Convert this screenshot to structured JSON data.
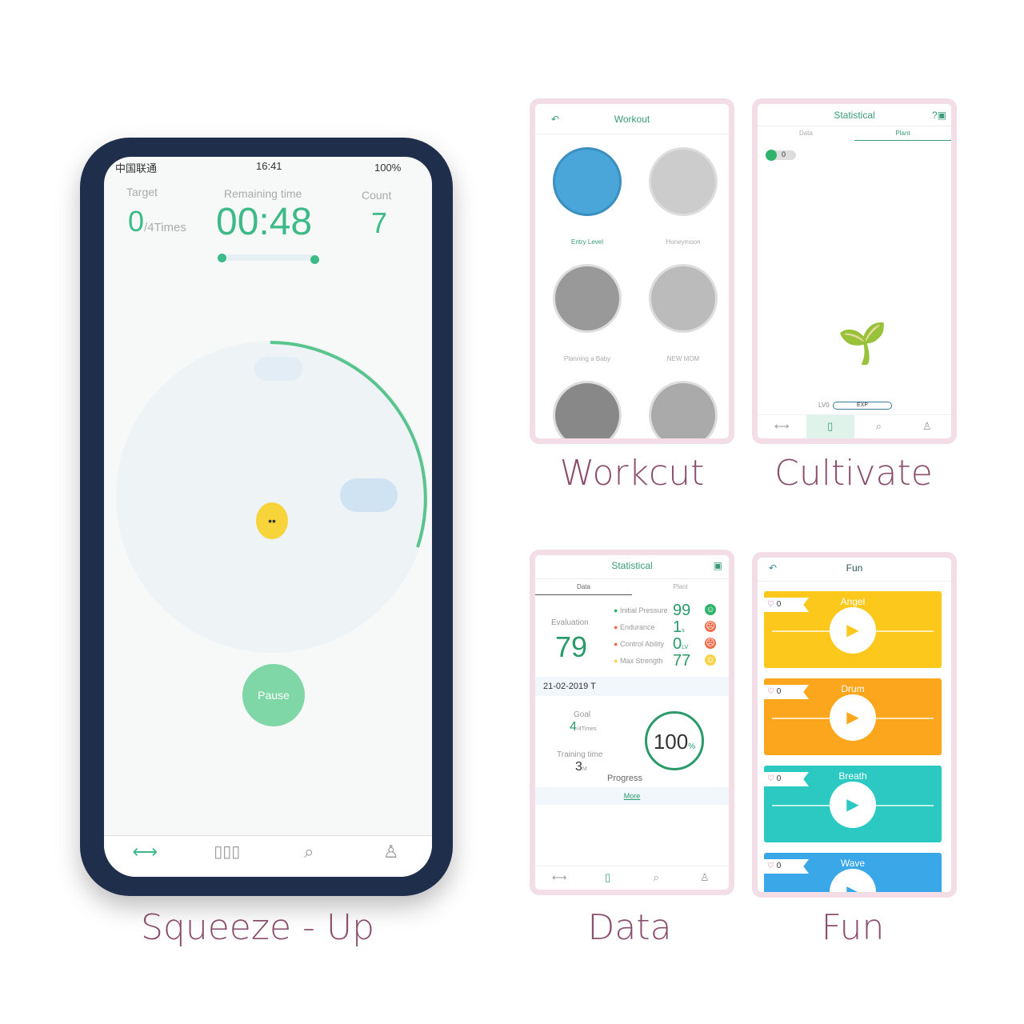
{
  "captions": {
    "workout": "Workcut",
    "cultivate": "Cultivate",
    "squeeze": "Squeeze - Up",
    "data": "Data",
    "fun": "Fun"
  },
  "main_phone": {
    "status": {
      "carrier": "中国联通",
      "time": "16:41",
      "battery": "100%"
    },
    "target_label": "Target",
    "target_value": "0",
    "target_unit": "/4Times",
    "remaining_label": "Remaining time",
    "remaining_value": "00:48",
    "count_label": "Count",
    "count_value": "7",
    "pause_label": "Pause",
    "nav": [
      {
        "icon": "dumbbell-icon"
      },
      {
        "icon": "bar-chart-icon"
      },
      {
        "icon": "search-icon"
      },
      {
        "icon": "user-icon"
      }
    ],
    "accent": "#3dba88"
  },
  "workout": {
    "title": "Workout",
    "items": [
      "Entry Level",
      "Honeymoon",
      "Planning a Baby",
      "NEW MOM"
    ]
  },
  "cultivate": {
    "title": "Statistical",
    "tabs": [
      "Data",
      "Plant"
    ],
    "toggle_value": "0",
    "level": "LV0",
    "exp": "EXP"
  },
  "data": {
    "title": "Statistical",
    "tabs": [
      "Data",
      "Plant"
    ],
    "evaluation_label": "Evaluation",
    "evaluation_value": "79",
    "metrics": [
      {
        "label": "Initial Pressure",
        "value": "99",
        "unit": "",
        "mood": "happy",
        "color": "#2fb36c"
      },
      {
        "label": "Endurance",
        "value": "1",
        "unit": "s",
        "mood": "sad",
        "color": "#f26b4a"
      },
      {
        "label": "Control Ability",
        "value": "0",
        "unit": "LV",
        "mood": "sad",
        "color": "#f26b4a"
      },
      {
        "label": "Max Strength",
        "value": "77",
        "unit": "",
        "mood": "neutral",
        "color": "#f6d34a"
      }
    ],
    "date": "21-02-2019 T",
    "goal_label": "Goal",
    "goal_value": "4",
    "goal_unit": "/4Times",
    "training_label": "Training time",
    "training_value": "3",
    "training_unit": "M",
    "progress_value": "100",
    "progress_unit": "%",
    "progress_label": "Progress",
    "more": "More"
  },
  "fun": {
    "title": "Fun",
    "items": [
      {
        "name": "Angel",
        "likes": "0",
        "color": "#fdc81c"
      },
      {
        "name": "Drum",
        "likes": "0",
        "color": "#fba61d"
      },
      {
        "name": "Breath",
        "likes": "0",
        "color": "#2cc9c2"
      },
      {
        "name": "Wave",
        "likes": "0",
        "color": "#3aa8e8"
      }
    ]
  }
}
